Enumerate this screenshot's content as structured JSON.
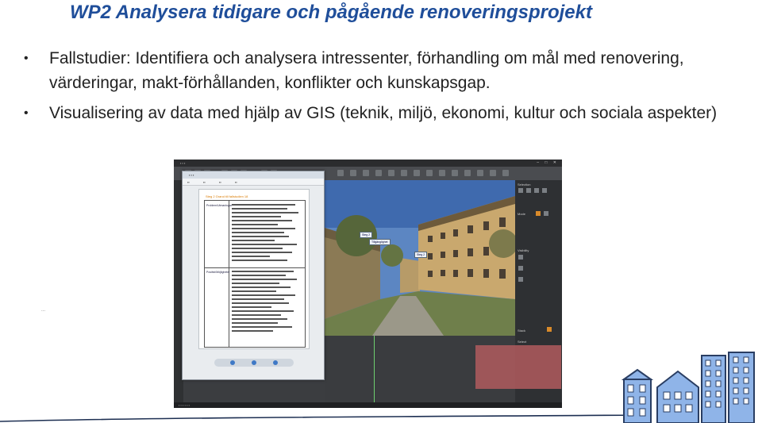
{
  "slide": {
    "title": "WP2 Analysera tidigare och pågående renoveringsprojekt",
    "bullets": [
      "Fallstudier: Identifiera och analysera intressenter, förhandling om mål med renovering, värderingar, makt-förhållanden, konflikter och kunskapsgap.",
      "Visualisering av data med hjälp av GIS (teknik, miljö, ekonomi, kultur och sociala aspekter)"
    ],
    "bullet_glyph": "•",
    "side_mark": "..."
  },
  "screenshot": {
    "doc_window": {
      "heading": "Steg 2 Grand till fallstudien 18",
      "row1_label": "Problem/Utmaningar",
      "row2_label": "Positivt/Möjligheter"
    },
    "right_panel": {
      "section1": "Selection",
      "section2": "Visibility",
      "mode_label": "Mode",
      "stack_label": "Stack",
      "select_label": "Select"
    },
    "callouts": [
      "Steg 2",
      "Tillgänglighet",
      "Steg 2"
    ]
  },
  "colors": {
    "title": "#1f4e9a",
    "text": "#222222",
    "sky": "#5c86c2",
    "facade": "#c9a86e",
    "building_blue": "#8fb4e8",
    "building_stroke": "#2a3e63"
  },
  "icons": [
    "bullet-dot",
    "window-controls",
    "toolbar-icons",
    "playback-controls",
    "buildings-illustration"
  ]
}
